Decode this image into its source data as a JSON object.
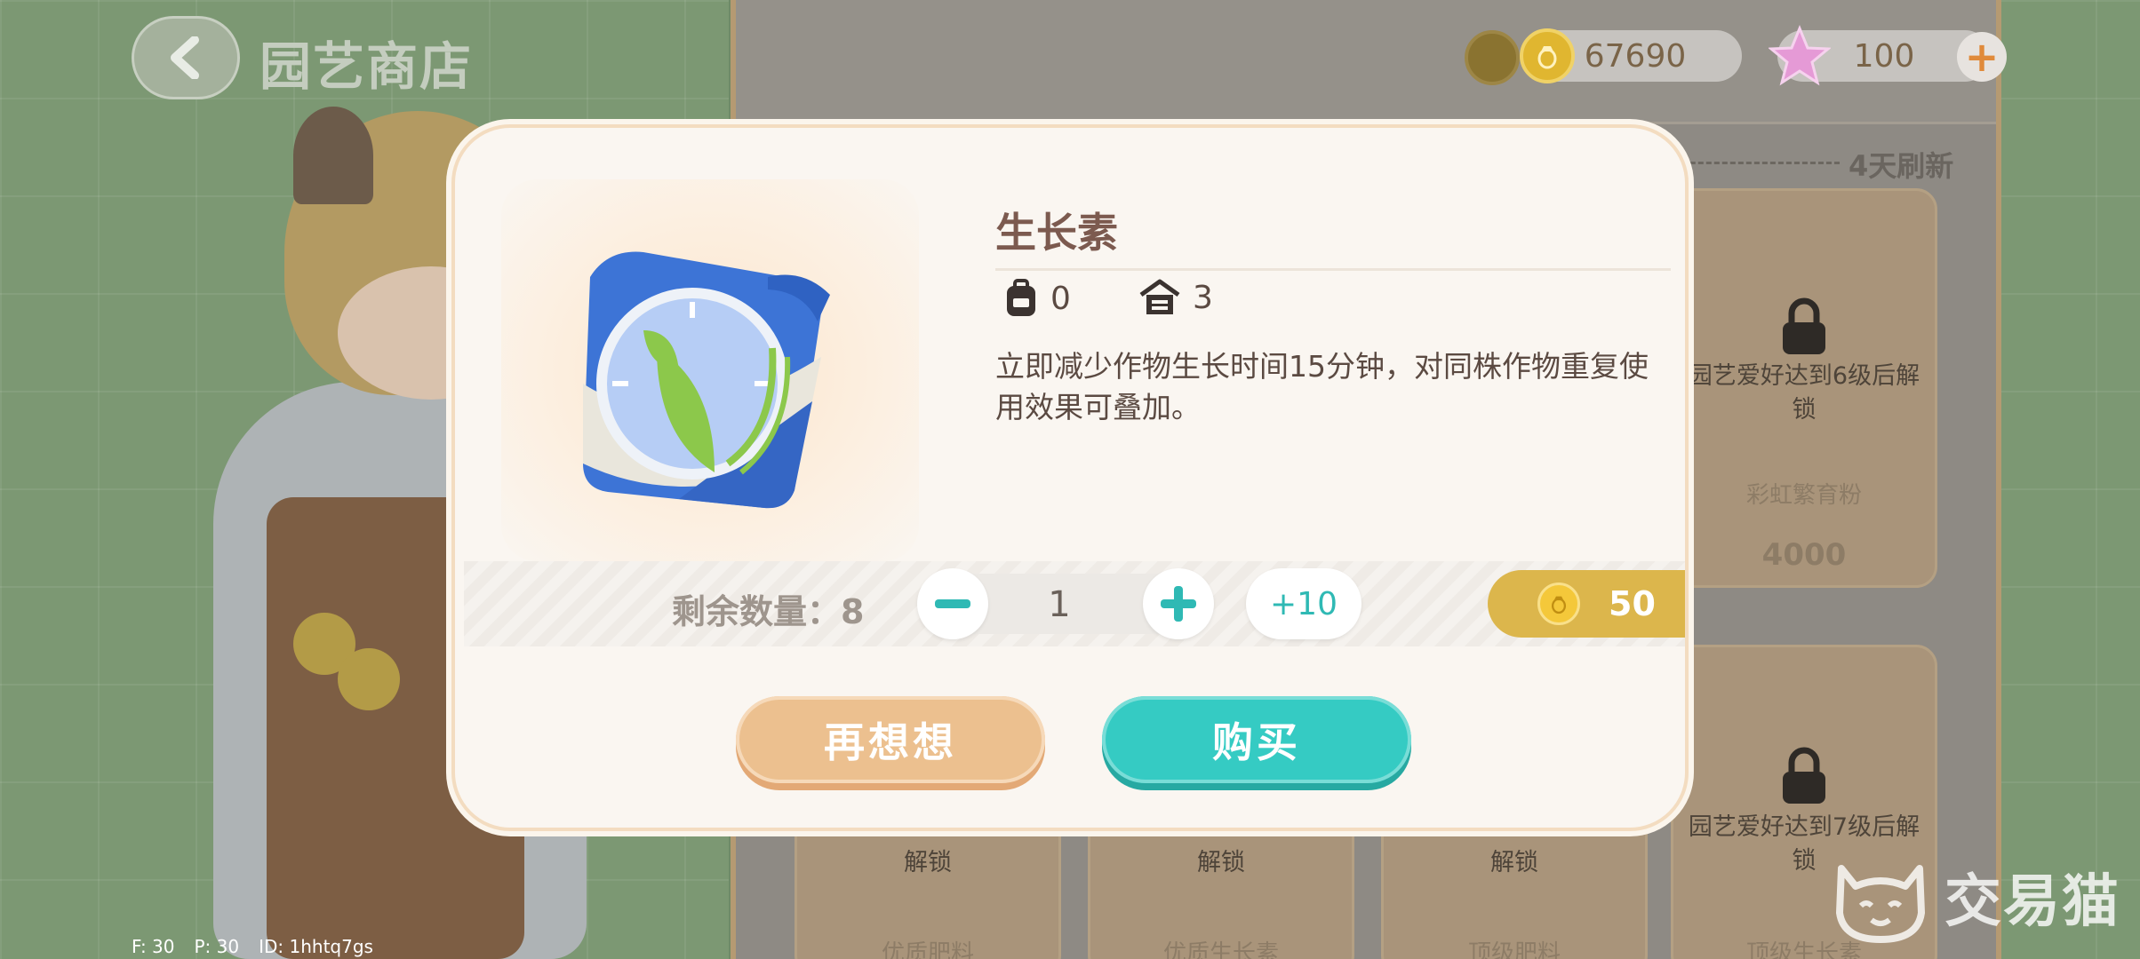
{
  "header": {
    "title": "园艺商店"
  },
  "currency": {
    "coins": "67690",
    "stars": "100",
    "add": "+"
  },
  "shop": {
    "refresh_text": "4天刷新",
    "cards": [
      {
        "unlock": "园艺爱好达到6级后解锁",
        "name": "彩虹繁育粉",
        "price": "4000"
      },
      {
        "unlock": "解锁",
        "name": "优质肥料"
      },
      {
        "unlock": "解锁",
        "name": "优质生长素"
      },
      {
        "unlock": "解锁",
        "name": "顶级肥料"
      },
      {
        "unlock": "园艺爱好达到7级后解锁",
        "name": "顶级生长素"
      }
    ]
  },
  "debug": {
    "f": "F: 30",
    "p": "P: 30",
    "id": "ID: 1hhtq7gs"
  },
  "modal": {
    "item_name": "生长素",
    "backpack_count": "0",
    "warehouse_count": "3",
    "description": "立即减少作物生长时间15分钟，对同株作物重复使用效果可叠加。",
    "remaining_label": "剩余数量：8",
    "quantity": "1",
    "plus10": "+10",
    "price": "50",
    "cancel_label": "再想想",
    "buy_label": "购买"
  },
  "watermark": {
    "text": "交易猫"
  },
  "colors": {
    "accent_teal": "#35cbc3",
    "cancel_orange": "#ecc08f",
    "coin_gold": "#dcb64c",
    "title_brown": "#7c5a4f"
  }
}
